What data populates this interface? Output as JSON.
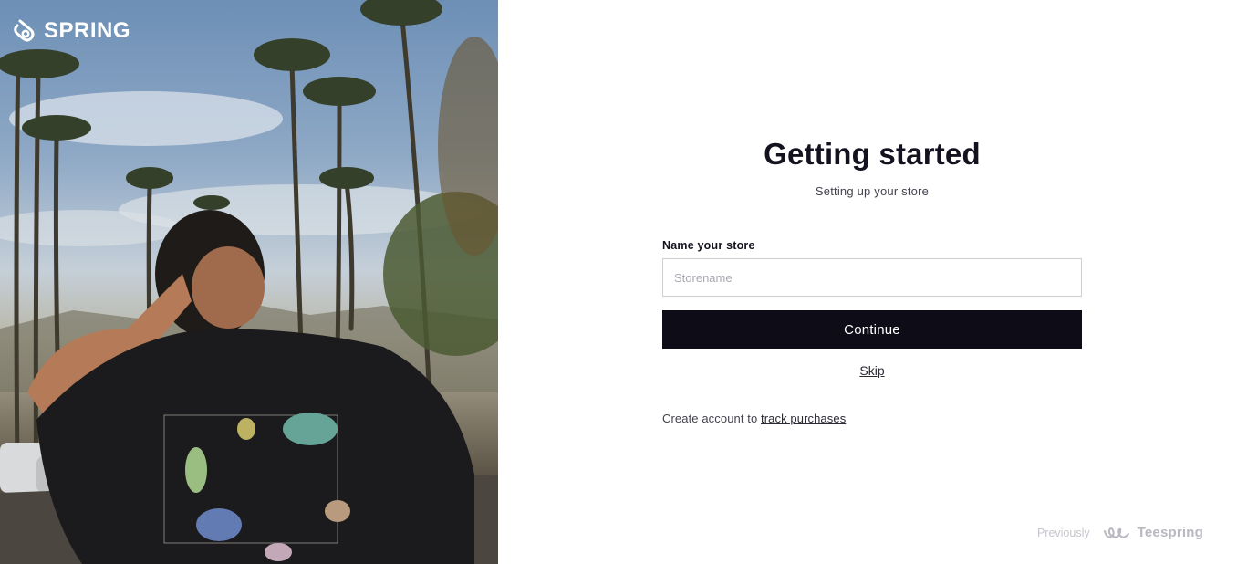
{
  "brand": {
    "name": "SPRING",
    "icon": "spring-logo-icon"
  },
  "hero": {
    "image": "photo-person-in-printed-tshirt-with-palm-trees"
  },
  "form": {
    "title": "Getting started",
    "subtitle": "Setting up your store",
    "store_label": "Name your store",
    "store_input": {
      "value": "",
      "placeholder": "Storename"
    },
    "continue_label": "Continue",
    "skip_label": "Skip",
    "account_text": "Create account to ",
    "account_link": "track purchases"
  },
  "footer": {
    "previously": "Previously",
    "old_brand": "Teespring",
    "old_brand_icon": "teespring-logo-icon"
  },
  "colors": {
    "primary_button": "#0e0c17",
    "text": "#14121f",
    "muted": "#c7c5cc",
    "input_border": "#cfcdd4"
  }
}
